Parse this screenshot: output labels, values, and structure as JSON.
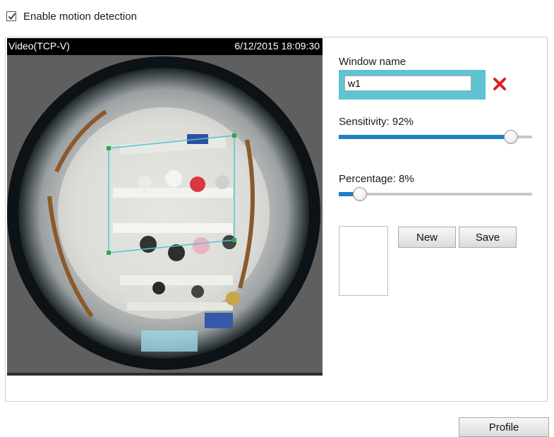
{
  "motion": {
    "enable_label": "Enable motion detection",
    "enabled": true
  },
  "video": {
    "title": "Video(TCP-V)",
    "timestamp": "6/12/2015 18:09:30"
  },
  "window": {
    "name_label": "Window name",
    "name_value": "w1"
  },
  "sensitivity": {
    "label": "Sensitivity: 92%",
    "value": 0.92
  },
  "percentage": {
    "label": "Percentage: 8%",
    "value": 0.08
  },
  "buttons": {
    "new_label": "New",
    "save_label": "Save",
    "profile_label": "Profile"
  },
  "colors": {
    "accent": "#1f7fc4",
    "window_highlight": "#5fc3d1",
    "delete": "#e0201c",
    "roi_outline": "#4fc6d6",
    "roi_handles": "#2da84a"
  },
  "icons": {
    "checkbox": "checkmark-icon",
    "delete": "red-x-icon"
  }
}
